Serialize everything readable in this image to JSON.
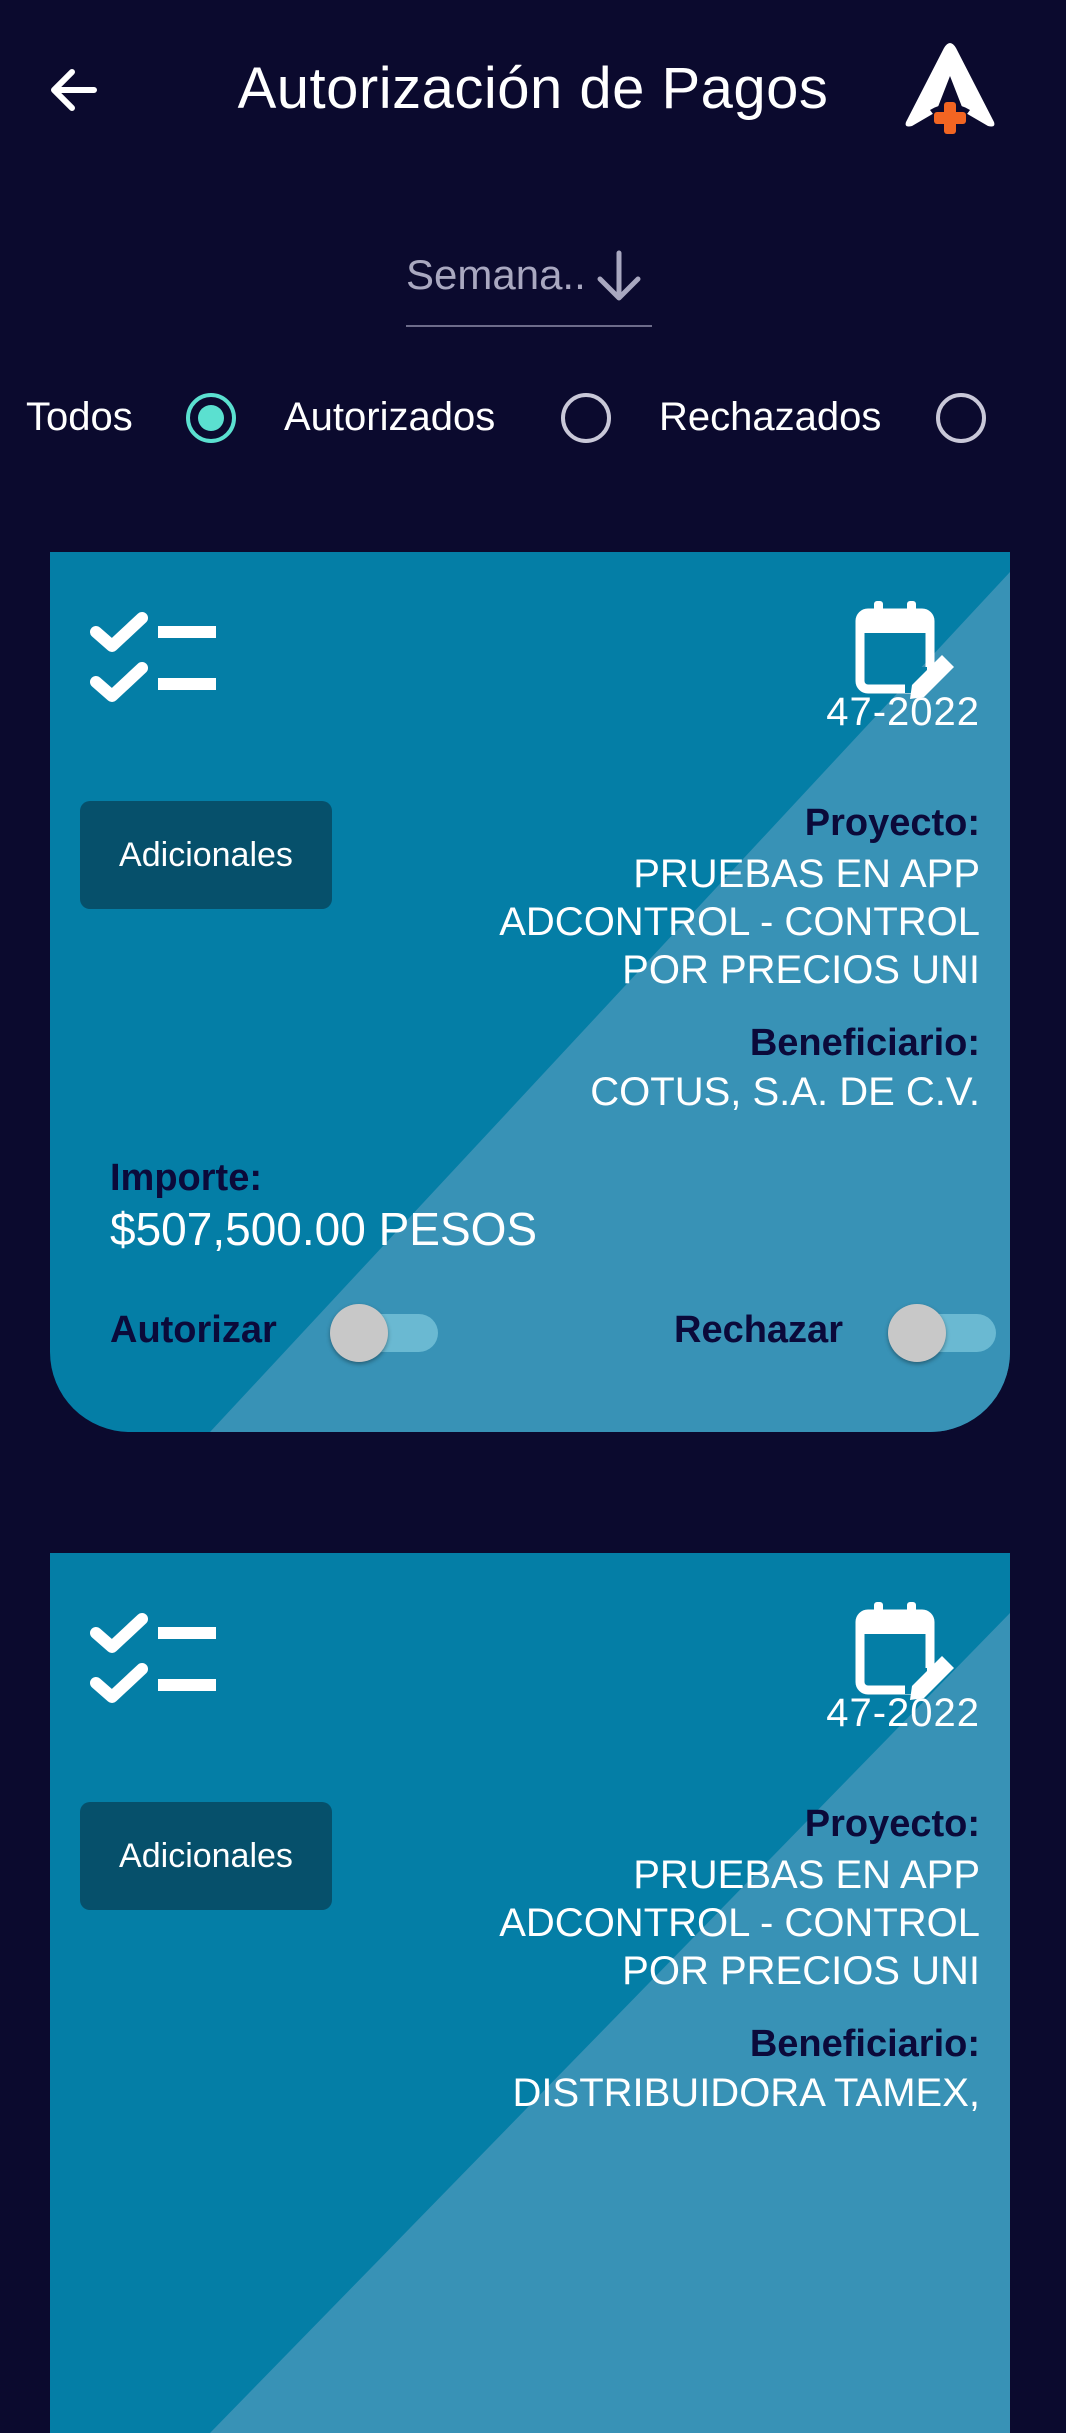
{
  "header": {
    "title": "Autorización de Pagos",
    "back_icon": "arrow-left-icon",
    "logo_icon": "adcontrol-logo",
    "accent_color": "#f26522"
  },
  "week_selector": {
    "label": "Semana..",
    "icon": "arrow-down-icon"
  },
  "filters": [
    {
      "label": "Todos",
      "selected": true
    },
    {
      "label": "Autorizados",
      "selected": false
    },
    {
      "label": "Rechazados",
      "selected": false
    }
  ],
  "cards": [
    {
      "week": "47-2022",
      "button_label": "Adicionales",
      "project_label": "Proyecto:",
      "project_value": "PRUEBAS EN APP ADCONTROL - CONTROL POR PRECIOS UNI",
      "beneficiary_label": "Beneficiario:",
      "beneficiary_value": "COTUS, S.A. DE C.V.",
      "amount_label": "Importe:",
      "amount_value": "$507,500.00 PESOS",
      "authorize_label": "Autorizar",
      "authorize_on": false,
      "reject_label": "Rechazar",
      "reject_on": false
    },
    {
      "week": "47-2022",
      "button_label": "Adicionales",
      "project_label": "Proyecto:",
      "project_value": "PRUEBAS EN APP ADCONTROL - CONTROL POR PRECIOS UNI",
      "beneficiary_label": "Beneficiario:",
      "beneficiary_value": "DISTRIBUIDORA TAMEX,"
    }
  ],
  "colors": {
    "background": "#0b0a2e",
    "card": "#047ea6",
    "card_light": "#3892b6",
    "button": "#06506b",
    "radio_selected": "#5be0d0"
  }
}
